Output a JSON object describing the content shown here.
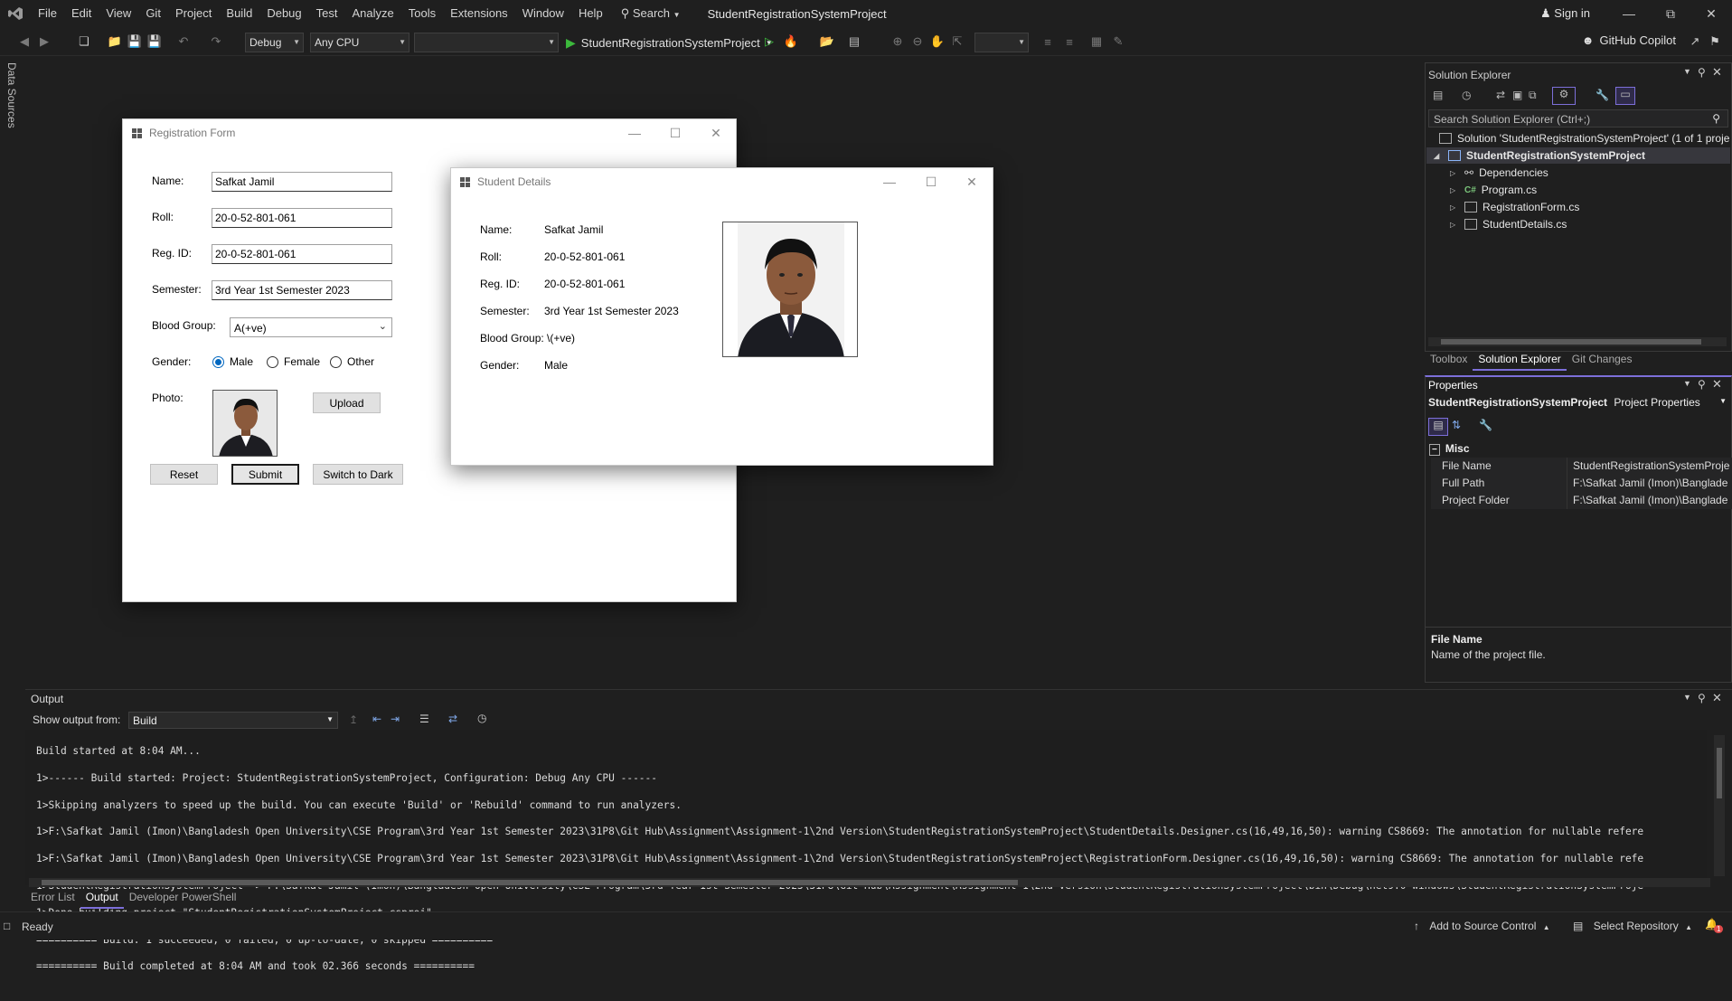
{
  "menubar": {
    "items": [
      "File",
      "Edit",
      "View",
      "Git",
      "Project",
      "Build",
      "Debug",
      "Test",
      "Analyze",
      "Tools",
      "Extensions",
      "Window",
      "Help"
    ],
    "search_label": "Search",
    "solution_title": "StudentRegistrationSystemProject",
    "sign_in": "Sign in"
  },
  "toolbar": {
    "config": "Debug",
    "platform": "Any CPU",
    "startup_project": "StudentRegistrationSystemProject",
    "copilot": "GitHub Copilot"
  },
  "side_strip": {
    "label": "Data Sources"
  },
  "registration_form": {
    "title": "Registration Form",
    "labels": {
      "name": "Name:",
      "roll": "Roll:",
      "reg_id": "Reg. ID:",
      "semester": "Semester:",
      "blood_group": "Blood Group:",
      "gender": "Gender:",
      "photo": "Photo:"
    },
    "values": {
      "name": "Safkat Jamil",
      "roll": "20-0-52-801-061",
      "reg_id": "20-0-52-801-061",
      "semester": "3rd Year 1st Semester 2023",
      "blood_group": "A(+ve)"
    },
    "gender_options": [
      "Male",
      "Female",
      "Other"
    ],
    "gender_selected": "Male",
    "buttons": {
      "upload": "Upload",
      "reset": "Reset",
      "submit": "Submit",
      "switch": "Switch to Dark"
    }
  },
  "student_details": {
    "title": "Student Details",
    "labels": {
      "name": "Name:",
      "roll": "Roll:",
      "reg_id": "Reg. ID:",
      "semester": "Semester:",
      "blood_group": "Blood Group:",
      "gender": "Gender:"
    },
    "values": {
      "name": "Safkat Jamil",
      "roll": "20-0-52-801-061",
      "reg_id": "20-0-52-801-061",
      "semester": "3rd Year 1st Semester 2023",
      "blood_group": "\\(+ve)",
      "gender": "Male"
    }
  },
  "solution_explorer": {
    "title": "Solution Explorer",
    "search_placeholder": "Search Solution Explorer (Ctrl+;)",
    "solution_row": "Solution 'StudentRegistrationSystemProject' (1 of 1 proje",
    "project_row": "StudentRegistrationSystemProject",
    "items": [
      "Dependencies",
      "Program.cs",
      "RegistrationForm.cs",
      "StudentDetails.cs"
    ],
    "tabs": [
      "Toolbox",
      "Solution Explorer",
      "Git Changes"
    ]
  },
  "properties": {
    "title": "Properties",
    "object_name": "StudentRegistrationSystemProject",
    "object_type": "Project Properties",
    "category": "Misc",
    "rows": [
      {
        "key": "File Name",
        "value": "StudentRegistrationSystemProje"
      },
      {
        "key": "Full Path",
        "value": "F:\\Safkat Jamil (Imon)\\Banglade"
      },
      {
        "key": "Project Folder",
        "value": "F:\\Safkat Jamil (Imon)\\Banglade"
      }
    ],
    "desc_title": "File Name",
    "desc_text": "Name of the project file."
  },
  "output": {
    "title": "Output",
    "show_from_label": "Show output from:",
    "show_from_value": "Build",
    "lines": [
      "Build started at 8:04 AM...",
      "1>------ Build started: Project: StudentRegistrationSystemProject, Configuration: Debug Any CPU ------",
      "1>Skipping analyzers to speed up the build. You can execute 'Build' or 'Rebuild' command to run analyzers.",
      "1>F:\\Safkat Jamil (Imon)\\Bangladesh Open University\\CSE Program\\3rd Year 1st Semester 2023\\31P8\\Git Hub\\Assignment\\Assignment-1\\2nd Version\\StudentRegistrationSystemProject\\StudentDetails.Designer.cs(16,49,16,50): warning CS8669: The annotation for nullable refere",
      "1>F:\\Safkat Jamil (Imon)\\Bangladesh Open University\\CSE Program\\3rd Year 1st Semester 2023\\31P8\\Git Hub\\Assignment\\Assignment-1\\2nd Version\\StudentRegistrationSystemProject\\RegistrationForm.Designer.cs(16,49,16,50): warning CS8669: The annotation for nullable refe",
      "1>StudentRegistrationSystemProject -> F:\\Safkat Jamil (Imon)\\Bangladesh Open University\\CSE Program\\3rd Year 1st Semester 2023\\31P8\\Git Hub\\Assignment\\Assignment-1\\2nd Version\\StudentRegistrationSystemProject\\bin\\Debug\\net9.0-windows\\StudentRegistrationSystemProje",
      "1>Done building project \"StudentRegistrationSystemProject.csproj\".",
      "========== Build: 1 succeeded, 0 failed, 0 up-to-date, 0 skipped ==========",
      "========== Build completed at 8:04 AM and took 02.366 seconds =========="
    ],
    "tabs": [
      "Error List",
      "Output",
      "Developer PowerShell"
    ]
  },
  "statusbar": {
    "ready": "Ready",
    "source_control": "Add to Source Control",
    "repository": "Select Repository",
    "notifications": "1"
  },
  "colors": {
    "accent": "#7c6fd9",
    "run_green": "#3cb93c",
    "radio_blue": "#0067c0"
  }
}
